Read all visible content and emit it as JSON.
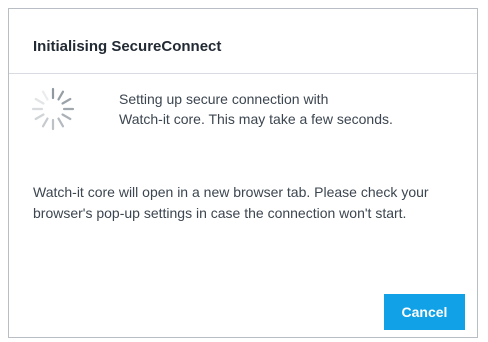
{
  "dialog": {
    "title": "Initialising SecureConnect",
    "status_line_1": "Setting up secure connection with",
    "status_line_2": "Watch-it core. This may take a few seconds.",
    "info": "Watch-it core will open in a new browser tab. Please check your browser's pop-up settings in case the connection won't start.",
    "cancel_label": "Cancel"
  },
  "colors": {
    "accent": "#11a1e6",
    "spinner": "#8a939b"
  },
  "icons": {
    "spinner": "loading-spinner-icon"
  }
}
